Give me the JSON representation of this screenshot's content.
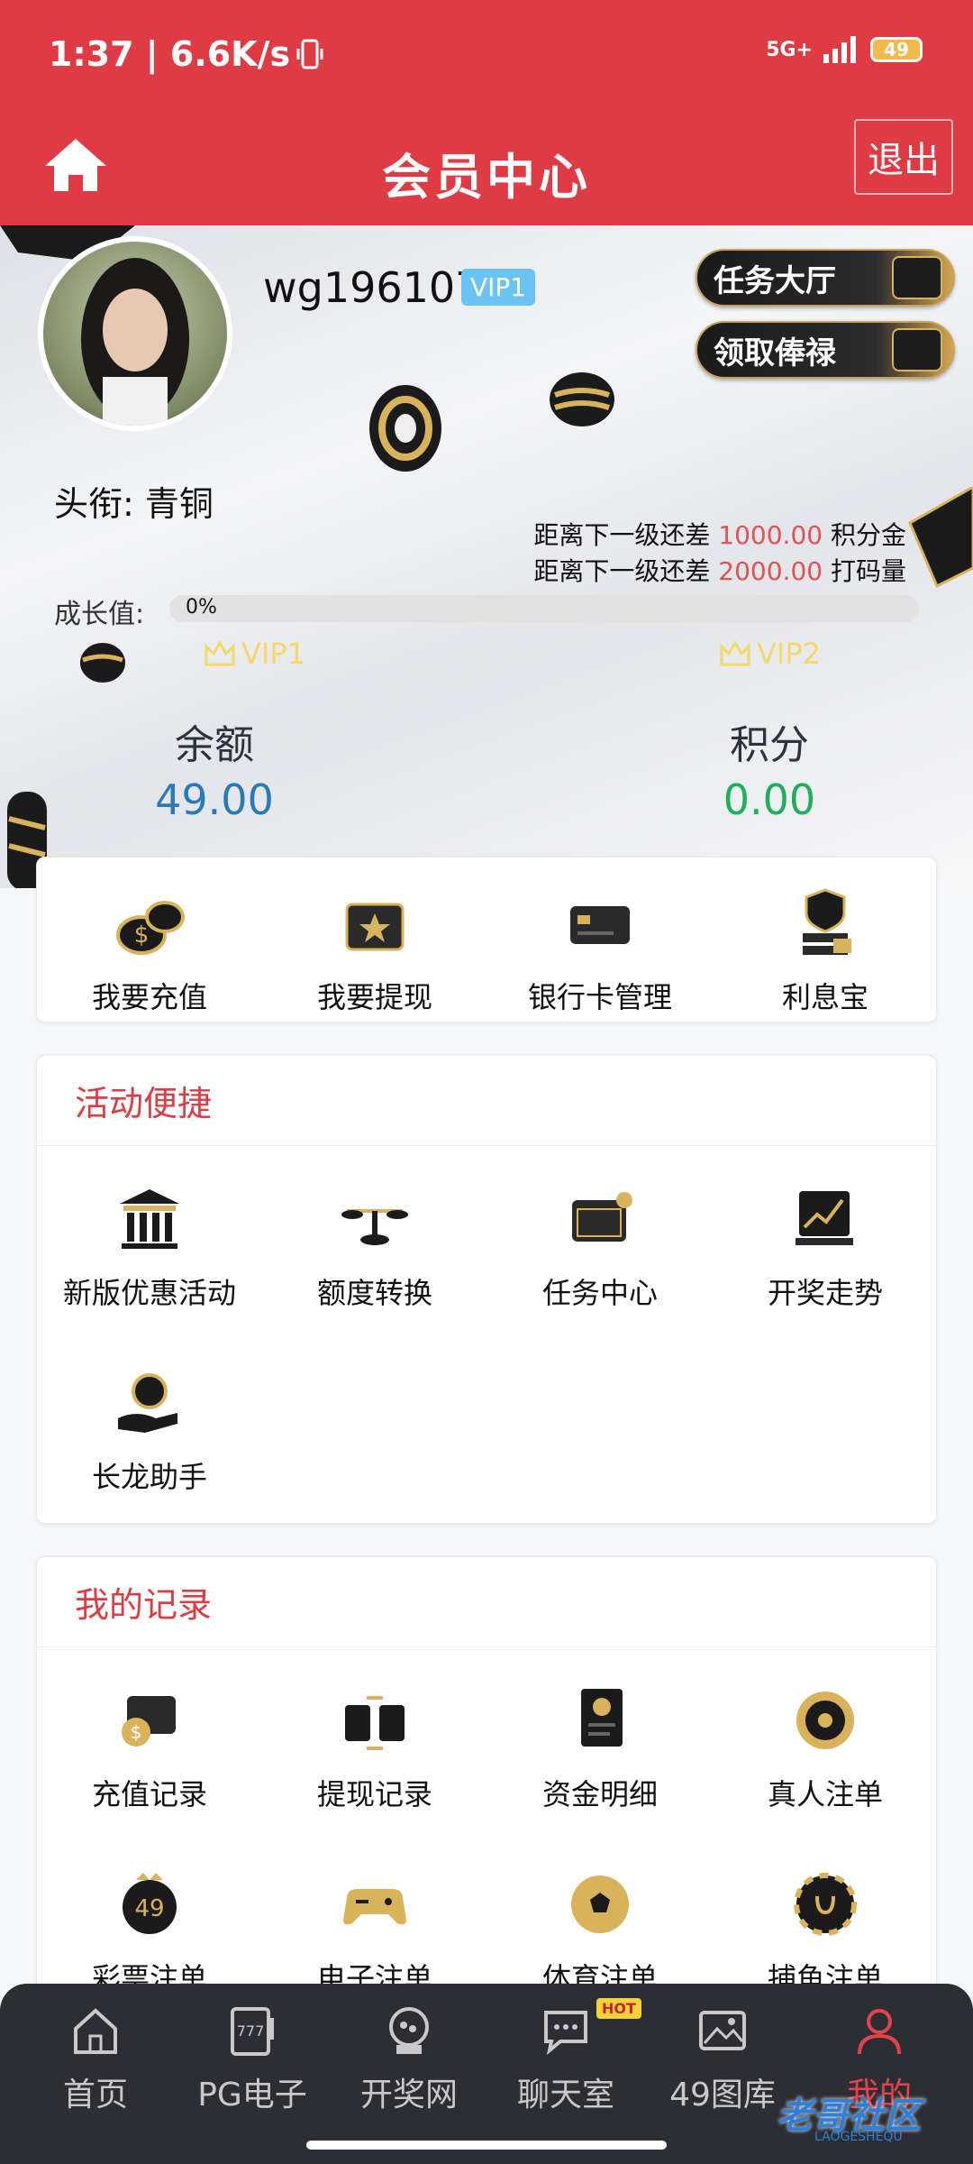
{
  "status": {
    "time_speed": "1:37 | 6.6K/s",
    "signal": "5G+",
    "battery": "49"
  },
  "header": {
    "title": "会员中心",
    "logout": "退出"
  },
  "profile": {
    "username": "wg196107",
    "vip": "VIP1",
    "task_hall": "任务大厅",
    "salary": "领取俸禄",
    "title_line": "头衔: 青铜",
    "next1_prefix": "距离下一级还差",
    "next1_value": "1000.00",
    "next1_suffix": "积分金",
    "next2_prefix": "距离下一级还差",
    "next2_value": "2000.00",
    "next2_suffix": "打码量",
    "growth_label": "成长值:",
    "growth_progress_percent": 0,
    "growth_text": "0%",
    "vip_current": "VIP1",
    "vip_next": "VIP2",
    "balance_label": "余额",
    "balance_value": "49.00",
    "points_label": "积分",
    "points_value": "0.00"
  },
  "quick": [
    "我要充值",
    "我要提现",
    "银行卡管理",
    "利息宝"
  ],
  "activity": {
    "title": "活动便捷",
    "items": [
      "新版优惠活动",
      "额度转换",
      "任务中心",
      "开奖走势",
      "长龙助手"
    ]
  },
  "records": {
    "title": "我的记录",
    "items": [
      "充值记录",
      "提现记录",
      "资金明细",
      "真人注单",
      "彩票注单",
      "电子注单",
      "体育注单",
      "捕鱼注单"
    ]
  },
  "nav": [
    "首页",
    "PG电子",
    "开奖网",
    "聊天室",
    "49图库",
    "我的"
  ],
  "nav_hot": "HOT",
  "watermark": "老哥社区",
  "watermark_sub": "LAOGESHEQU",
  "colors": {
    "brand_red": "#df3b45",
    "balance_blue": "#2b7ab8",
    "points_green": "#1fae5b",
    "nav_bg": "#2d2e33"
  }
}
